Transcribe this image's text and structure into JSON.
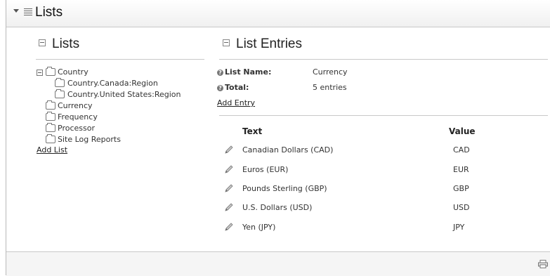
{
  "header": {
    "title": "Lists",
    "collapse_icon": "caret-down-icon",
    "module_icon": "list-lines-icon"
  },
  "lists_panel": {
    "heading": "Lists",
    "tree": [
      {
        "label": "Country",
        "level": 0,
        "expanded": true
      },
      {
        "label": "Country.Canada:Region",
        "level": 1
      },
      {
        "label": "Country.United States:Region",
        "level": 1
      },
      {
        "label": "Currency",
        "level": 0
      },
      {
        "label": "Frequency",
        "level": 0
      },
      {
        "label": "Processor",
        "level": 0
      },
      {
        "label": "Site Log Reports",
        "level": 0
      }
    ],
    "add_list": "Add List"
  },
  "entries_panel": {
    "heading": "List Entries",
    "list_name_label": "List Name:",
    "list_name_value": "Currency",
    "total_label": "Total:",
    "total_value": "5 entries",
    "add_entry": "Add Entry",
    "columns": {
      "text": "Text",
      "value": "Value"
    },
    "rows": [
      {
        "text": "Canadian Dollars (CAD)",
        "value": "CAD"
      },
      {
        "text": "Euros (EUR)",
        "value": "EUR"
      },
      {
        "text": "Pounds Sterling (GBP)",
        "value": "GBP"
      },
      {
        "text": "U.S. Dollars (USD)",
        "value": "USD"
      },
      {
        "text": "Yen (JPY)",
        "value": "JPY"
      }
    ]
  },
  "footer": {
    "print_icon": "print-icon"
  }
}
